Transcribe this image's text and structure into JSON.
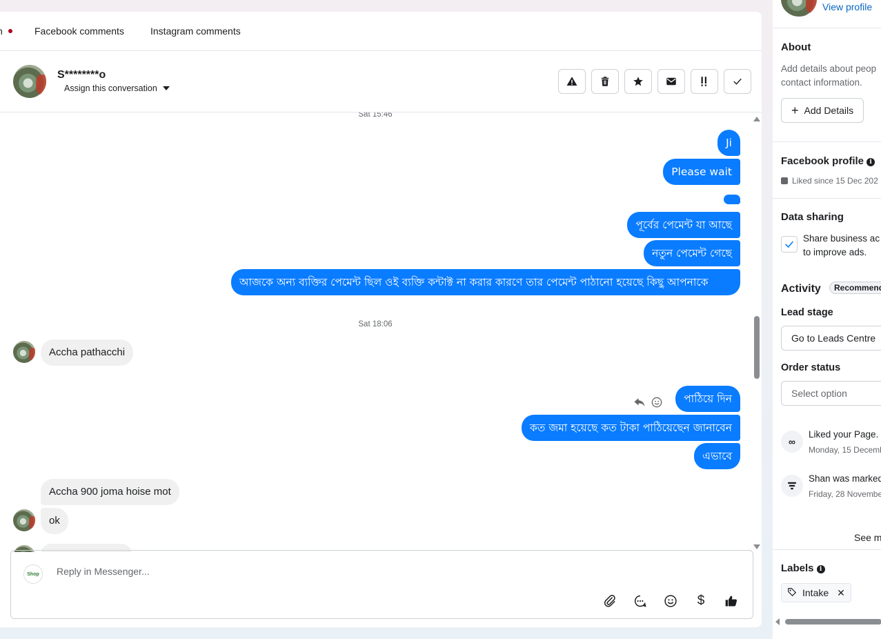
{
  "tabs": {
    "partial": "n",
    "facebook_comments": "Facebook comments",
    "instagram_comments": "Instagram comments"
  },
  "conversation": {
    "name": "S********o",
    "assign_label": "Assign this conversation",
    "actions": [
      "warning-icon",
      "trash-icon",
      "star-icon",
      "mail-icon",
      "important-icon",
      "check-icon"
    ]
  },
  "messages": {
    "ts1": "Sat 15:46",
    "out1": "Ji",
    "out2": "Please wait",
    "out3": "পূর্বের পেমেন্ট যা আছে",
    "out4": "নতুন পেমেন্ট গেছে",
    "out5": "আজকে অন্য ব্যক্তির পেমেন্ট ছিল ওই ব্যক্তি কন্টাক্ট না করার কারণে তার পেমেন্ট পাঠানো হয়েছে কিছু আপনাকে",
    "ts2": "Sat 18:06",
    "in1": "Accha pathacchi",
    "out6": "পাঠিয়ে দিন",
    "out7": "কত জমা হয়েছে কত টাকা পাঠিয়েছেন জানাবেন",
    "out8": "এভাবে",
    "in2": "Accha 900 joma hoise mot",
    "in3": "ok"
  },
  "reply": {
    "placeholder": "Reply in Messenger...",
    "page_logo_text": "Shop"
  },
  "sidebar": {
    "view_profile": "View profile",
    "about_title": "About",
    "about_text_1": "Add details about peop",
    "about_text_2": "contact information.",
    "add_details": "Add Details",
    "fb_profile_title": "Facebook profile",
    "liked_since": "Liked since 15 Dec 202",
    "data_sharing_title": "Data sharing",
    "data_sharing_text_1": "Share business ac",
    "data_sharing_text_2": "to improve ads.",
    "activity_title": "Activity",
    "activity_badge": "Recommend",
    "lead_stage_title": "Lead stage",
    "lead_stage_button": "Go to Leads Centre",
    "order_status_title": "Order status",
    "order_status_placeholder": "Select option",
    "activity_1": "Liked your Page.",
    "activity_1_date": "Monday, 15 Decemb",
    "activity_2": "Shan was marked",
    "activity_2_date": "Friday, 28 Novembe",
    "see_more": "See m",
    "labels_title": "Labels",
    "label_1": "Intake"
  },
  "colors": {
    "accent": "#0a7cff",
    "incoming_bubble": "#f0f0f0",
    "border": "#ccd0d5"
  }
}
